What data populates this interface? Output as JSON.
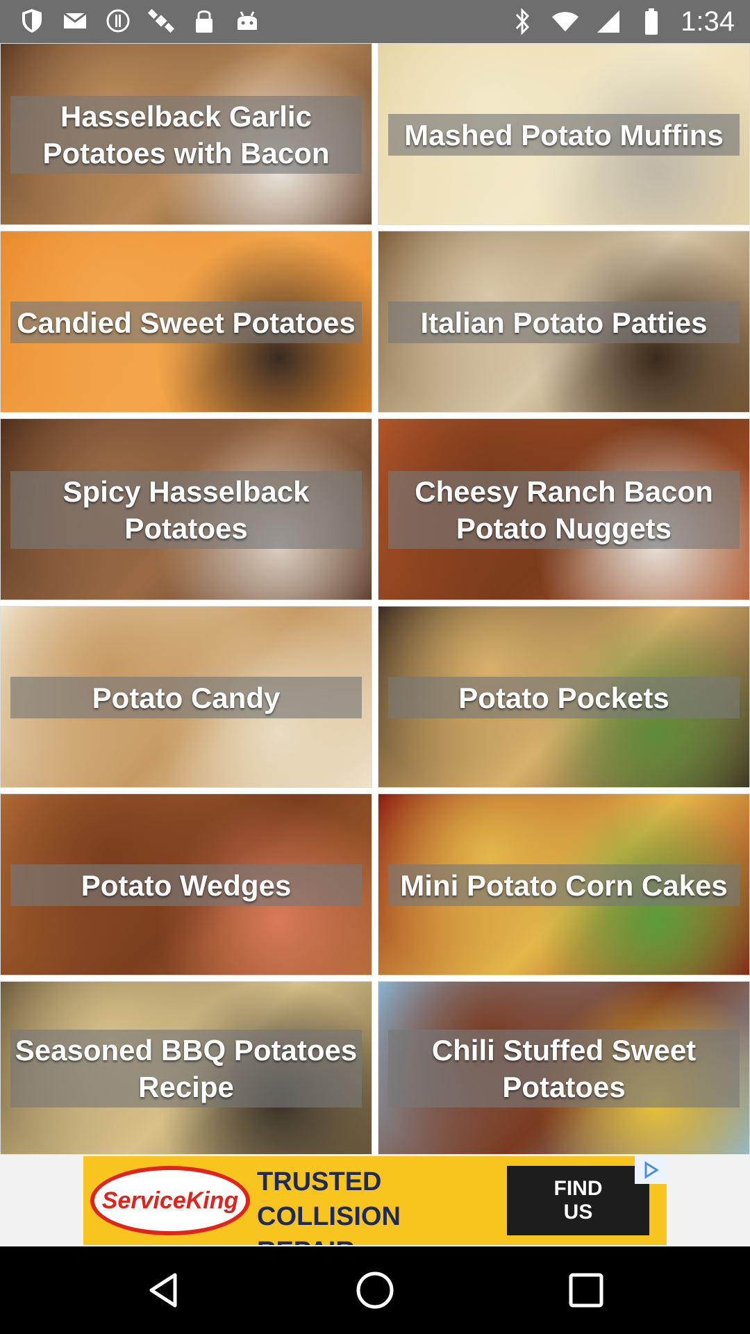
{
  "status_bar": {
    "time": "1:34",
    "left_icons": [
      "shield-icon",
      "mail-icon",
      "info-icon",
      "satellite-icon",
      "lock-icon",
      "android-icon"
    ],
    "right_icons": [
      "bluetooth-icon",
      "wifi-icon",
      "signal-icon",
      "battery-icon"
    ]
  },
  "recipes": [
    {
      "title": "Hasselback Garlic Potatoes with Bacon",
      "image": "hasselback-garlic-photo",
      "colors": [
        "#5b3a23",
        "#b98a5a",
        "#e9e4dc"
      ]
    },
    {
      "title": "Mashed Potato Muffins",
      "image": "muffins-photo",
      "colors": [
        "#e7d4a2",
        "#f2e8c8",
        "#bfb7a8"
      ]
    },
    {
      "title": "Candied Sweet Potatoes",
      "image": "candied-sweet-potatoes-photo",
      "colors": [
        "#e8892a",
        "#f4a54a",
        "#3a2a22"
      ]
    },
    {
      "title": "Italian Potato Patties",
      "image": "potato-patties-photo",
      "colors": [
        "#7a5a34",
        "#d8c7a8",
        "#3b2a1b"
      ]
    },
    {
      "title": "Spicy Hasselback Potatoes",
      "image": "spicy-hasselback-photo",
      "colors": [
        "#4e2e1a",
        "#9a6a45",
        "#d9cfc4"
      ]
    },
    {
      "title": "Cheesy Ranch Bacon Potato Nuggets",
      "image": "nuggets-photo",
      "colors": [
        "#b3562a",
        "#7a3b1b",
        "#e7e2da"
      ]
    },
    {
      "title": "Potato Candy",
      "image": "potato-candy-photo",
      "colors": [
        "#efe3c9",
        "#c79a63",
        "#e9dcc0"
      ]
    },
    {
      "title": "Potato Pockets",
      "image": "potato-pockets-photo",
      "colors": [
        "#3a2a1f",
        "#d8b06a",
        "#5f8a3a"
      ]
    },
    {
      "title": "Potato Wedges",
      "image": "potato-wedges-photo",
      "colors": [
        "#b06a35",
        "#7b3e1e",
        "#d97a5a"
      ]
    },
    {
      "title": "Mini Potato Corn Cakes",
      "image": "corn-cakes-photo",
      "colors": [
        "#8a1a12",
        "#e4b74a",
        "#5a9a3a"
      ]
    },
    {
      "title": "Seasoned BBQ Potatoes Recipe",
      "image": "bbq-potatoes-photo",
      "colors": [
        "#6b5a3a",
        "#d8c18a",
        "#3a3228"
      ]
    },
    {
      "title": "Chili Stuffed Sweet Potatoes",
      "image": "chili-stuffed-photo",
      "colors": [
        "#8ab7d8",
        "#7a3a1f",
        "#e8c23a"
      ]
    }
  ],
  "ad": {
    "brand": "ServiceKing",
    "tagline_line1": "TRUSTED",
    "tagline_line2": "COLLISION REPAIR",
    "cta_line1": "FIND",
    "cta_line2": "US",
    "colors": {
      "background": "#f7c51d",
      "brand": "#e0241b",
      "cta": "#1d1d1d"
    }
  },
  "nav_bar": {
    "buttons": [
      "back-icon",
      "home-icon",
      "recents-icon"
    ]
  }
}
